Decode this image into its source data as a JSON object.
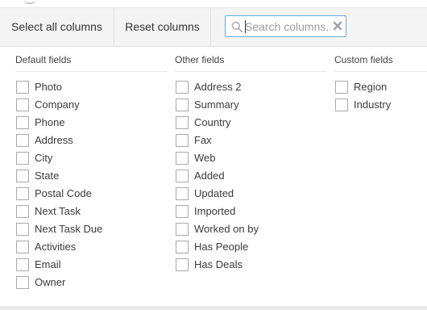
{
  "toolbar": {
    "select_all_label": "Select all columns",
    "reset_label": "Reset columns",
    "search": {
      "placeholder": "Search columns...",
      "value": "",
      "icon": "search-icon",
      "clear_icon": "clear-icon"
    }
  },
  "columns": [
    {
      "title": "Default fields",
      "items": [
        "Photo",
        "Company",
        "Phone",
        "Address",
        "City",
        "State",
        "Postal Code",
        "Next Task",
        "Next Task Due",
        "Activities",
        "Email",
        "Owner"
      ]
    },
    {
      "title": "Other fields",
      "items": [
        "Address 2",
        "Summary",
        "Country",
        "Fax",
        "Web",
        "Added",
        "Updated",
        "Imported",
        "Worked on by",
        "Has People",
        "Has Deals"
      ]
    },
    {
      "title": "Custom fields",
      "items": [
        "Region",
        "Industry"
      ]
    }
  ],
  "colors": {
    "toolbar_bg": "#f4f4f4",
    "search_border": "#6aa7dc",
    "checkbox_border": "#a9a9a9",
    "text": "#3a3a3a"
  }
}
